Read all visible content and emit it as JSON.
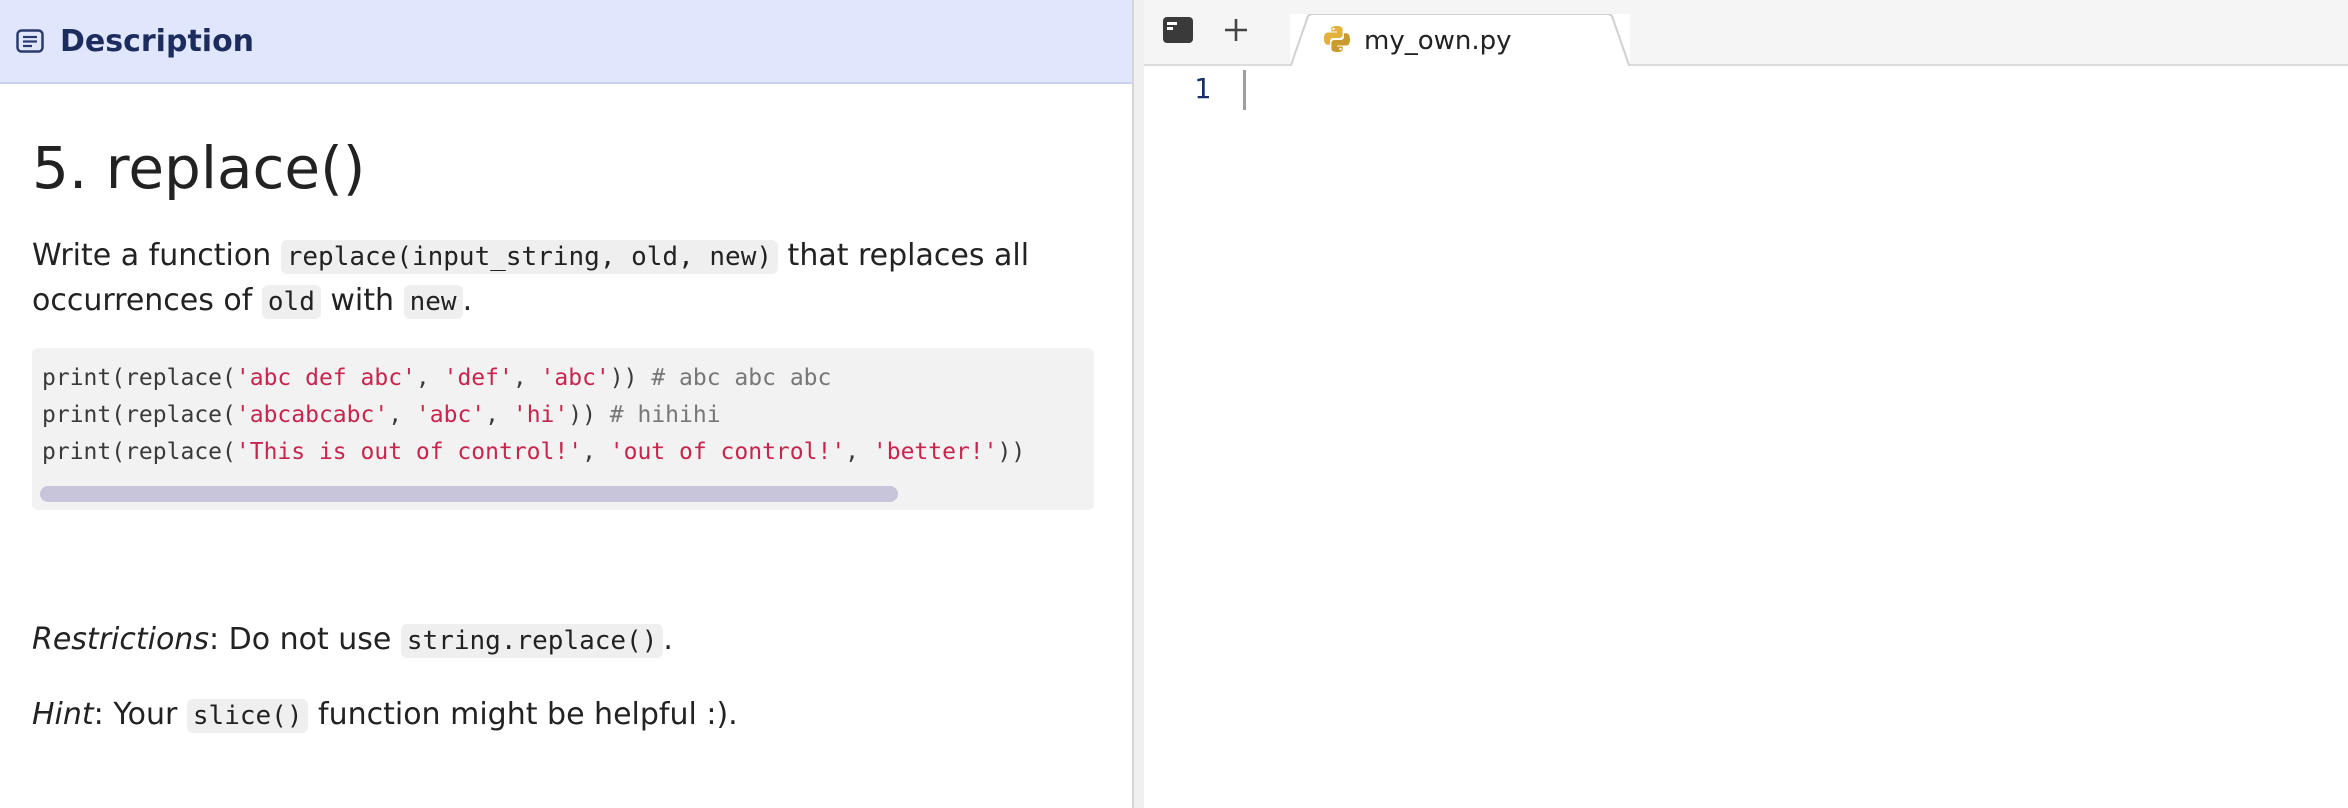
{
  "description_panel": {
    "header_title": "Description",
    "header_icon": "description-icon",
    "heading": "5. replace()",
    "intro": {
      "text1": "Write a function ",
      "code1": "replace(input_string, old, new)",
      "text2": " that replaces all occurrences of ",
      "code2": "old",
      "text3": " with ",
      "code3": "new",
      "text4": "."
    },
    "code_lines": [
      {
        "p1": "print(replace(",
        "s1": "'abc def abc'",
        "c1": ", ",
        "s2": "'def'",
        "c2": ", ",
        "s3": "'abc'",
        "p2": ")) ",
        "comment": "# abc abc abc"
      },
      {
        "p1": "print(replace(",
        "s1": "'abcabcabc'",
        "c1": ", ",
        "s2": "'abc'",
        "c2": ", ",
        "s3": "'hi'",
        "p2": ")) ",
        "comment": "# hihihi"
      },
      {
        "p1": "print(replace(",
        "s1": "'This is out of control!'",
        "c1": ", ",
        "s2": "'out of control!'",
        "c2": ", ",
        "s3": "'better!'",
        "p2": "))",
        "comment": ""
      }
    ],
    "restrictions": {
      "label": "Restrictions",
      "text": ": Do not use ",
      "code": "string.replace()",
      "end": "."
    },
    "hint": {
      "label": "Hint",
      "text": ": Your ",
      "code": "slice()",
      "end": " function might be helpful :)."
    }
  },
  "editor_panel": {
    "terminal_icon": "terminal-icon",
    "add_icon": "plus-icon",
    "tab": {
      "icon": "python-icon",
      "label": "my_own.py"
    },
    "line_number": "1"
  },
  "colors": {
    "header_bg": "#e0e6fb",
    "header_text": "#1d2c5e",
    "code_string": "#c7254e",
    "code_comment": "#777777",
    "scrollbar": "#c8c4d9",
    "line_number": "#1a2d6b"
  }
}
